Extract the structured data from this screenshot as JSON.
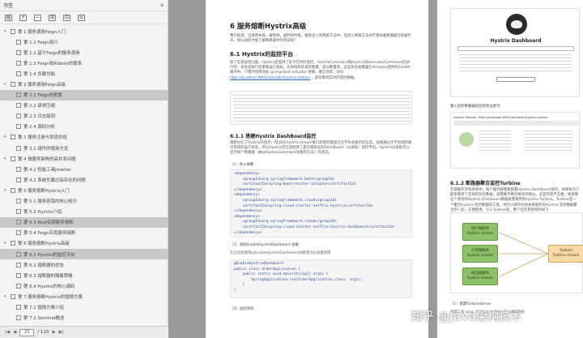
{
  "sidebar": {
    "title": "书签",
    "toc": [
      {
        "level": 1,
        "label": "第 1 服务调用Feign入门"
      },
      {
        "level": 2,
        "label": "第 1.1 Feign简介"
      },
      {
        "level": 2,
        "label": "第 1.2 基于Feign的服务调用"
      },
      {
        "level": 2,
        "label": "第 1.3 Feign和Ribbon的联系"
      },
      {
        "level": 2,
        "label": "第 1.4 负载均衡"
      },
      {
        "level": 1,
        "label": "第 2 服务调用Feign高级"
      },
      {
        "level": 2,
        "label": "第 2.1 Feign的配置",
        "selected": true
      },
      {
        "level": 2,
        "label": "第 2.2 请求压缩"
      },
      {
        "level": 2,
        "label": "第 2.3 日志级别"
      },
      {
        "level": 2,
        "label": "第 2.4 源码分析"
      },
      {
        "level": 1,
        "label": "第 3 服务注册与发现总结"
      },
      {
        "level": 2,
        "label": "第 3.1 组件的使用方式"
      },
      {
        "level": 1,
        "label": "第 4 微服务架构的高并发问题"
      },
      {
        "level": 2,
        "label": "第 4.1 性能工具Jmetter"
      },
      {
        "level": 2,
        "label": "第 4.2 系统负载过高存在的问题"
      },
      {
        "level": 1,
        "label": "第 5 服务熔断Hystrix入门"
      },
      {
        "level": 2,
        "label": "第 5.1 服务容错的核心知识"
      },
      {
        "level": 2,
        "label": "第 5.2 Hystrix介绍"
      },
      {
        "level": 2,
        "label": "第 5.3 Rest实现服务熔断",
        "selected": true
      },
      {
        "level": 2,
        "label": "第 5.4 Feign实现服务熔断"
      },
      {
        "level": 1,
        "label": "第 6 服务熔断Hystrix高级"
      },
      {
        "level": 2,
        "label": "第 6.1 Hystrix的监控平台",
        "selected": true
      },
      {
        "level": 2,
        "label": "第 6.2 熔断器的状态"
      },
      {
        "level": 2,
        "label": "第 6.3 熔断器的隔离策略"
      },
      {
        "level": 2,
        "label": "第 6.4 Hystrix的核心源码"
      },
      {
        "level": 1,
        "label": "第 7 服务熔断Hystrix的替换方案"
      },
      {
        "level": 2,
        "label": "第 7.1 替换方案介绍"
      },
      {
        "level": 2,
        "label": "第 7.2 Sentinel概述"
      }
    ],
    "footer": {
      "page_current": "21",
      "page_total": "/ 110"
    }
  },
  "page_left": {
    "h1": "6 服务熔断Hystrix高级",
    "intro": "我们知道，当请求失败，被拒绝，超时的时候，都会进入到降级方法中。但进入降级方法并不意味着断路器已经被打开。那么如何才能了解断路器中的状态呢？",
    "h2": "6.1 Hystrix的监控平台",
    "p1": "除了实现容错功能，Hystrix还提供了近乎实时的监控，HystrixCommand和HystrixObservableCommand在执行时，会生成执行结果和运行指标。比如每秒的请求数量，成功数量等。这些状态会暴露在Actuator提供的/health端点中。只需为项目添加 spring-boot-actuator 依赖，重启项目，访问",
    "p1_link": "http://localhost:9001/actuator/hystrix.stream",
    "p1_tail": "，即可看到实时的监控数据。",
    "h3": "6.1.1 搭建Hystrix DashBoard监控",
    "p2": "刚刚讨论了Hystrix的监控，但访问/hystrix.stream接口获取的都是已文字形式展示的信息。很难通过文字直观的展示系统的运行状态，所以Hystrix官方还提供了基于图形化的DashBoard（仪表板）监控平台。Hystrix仪表板可以显示每个断路器（被@HystrixCommand注解的方法）的状态。",
    "step1": "（1）导入依赖",
    "code1": [
      "<dependency>",
      "    <groupId>org.springframework.boot</groupId>",
      "    <artifactId>spring-boot-starter-actuator</artifactId>",
      "</dependency>",
      "<dependency>",
      "    <groupId>org.springframework.cloud</groupId>",
      "    <artifactId>spring-cloud-starter-netflix-hystrix</artifactId>",
      "</dependency>",
      "<dependency>",
      "    <groupId>org.springframework.cloud</groupId>",
      "    <artifactId>spring-cloud-starter-netflix-hystrix-dashboard</artifactId>",
      "</dependency>"
    ],
    "step2": "（2）添加EnableHystrixDashboard 注解",
    "step2_desc": "在启动类使用@EnableHystrixDashboard注解激活仪表盘项目",
    "code2": [
      "@EnableHystrixDashboard",
      "public class OrderApplication {",
      "    public static void main(String[] args) {",
      "        SpringApplication.run(OrderApplication.class, args);",
      "    }",
      "}"
    ],
    "step3": "（3）访问测试"
  },
  "page_right": {
    "hystrix_title": "Hystrix Dashboard",
    "caption1": "输入监控断路器的监控地址即可",
    "stream_label": "Hystrix Stream: http://localhost:9001/actuator/hystrix.stream",
    "h3": "6.1.2 断路器聚合监控Turbine",
    "p1": "在微服务架构体系中，每个服务都需要配置Hystrix DashBoard监控。如果每次只能查看单个实例的监控数据，就需要不断切换监控地址，这显然很不方便。要想看这个系统的Hystrix Dashboard数据就需要用到Hystrix Turbine。Turbine是一个聚合Hystrix 监控数据的工具，他可以将所有相关微服务的Hystrix 监控数据聚合到一起，方便使用。引入Turbine后，整个监控系统架构如下：",
    "nodes": [
      {
        "name": "用户微服务",
        "sub": "Hystrix stream"
      },
      {
        "name": "订单微服务",
        "sub": "Hystrix stream"
      },
      {
        "name": "商品微服务",
        "sub": "Hystrix stream"
      }
    ],
    "turbine": {
      "name": "Turbine",
      "sub": "Turbine stream"
    },
    "step1": "（1）搭建TurbineServer",
    "step1_desc": "创建工程 shop_hystrix_turbine 引入相关坐标"
  },
  "watermark": "知乎 @Java架构技术"
}
